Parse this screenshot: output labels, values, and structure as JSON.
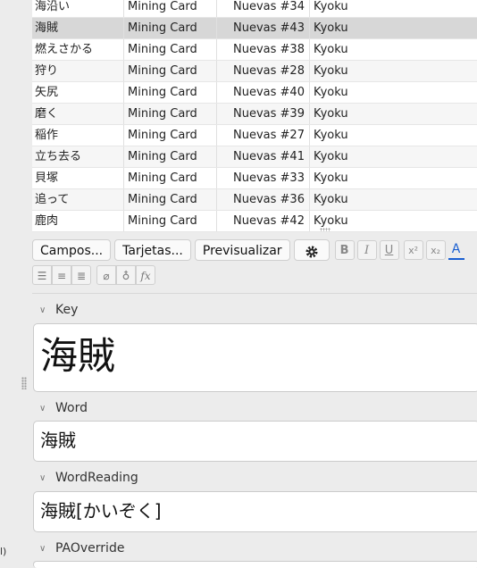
{
  "sidebar": {
    "clipped_text": "l)"
  },
  "table": {
    "rows": [
      {
        "sort": "海沿い",
        "note_type": "Mining Card",
        "card": "Nuevas #34",
        "deck": "Kyoku"
      },
      {
        "sort": "海賊",
        "note_type": "Mining Card",
        "card": "Nuevas #43",
        "deck": "Kyoku"
      },
      {
        "sort": "燃えさかる",
        "note_type": "Mining Card",
        "card": "Nuevas #38",
        "deck": "Kyoku"
      },
      {
        "sort": "狩り",
        "note_type": "Mining Card",
        "card": "Nuevas #28",
        "deck": "Kyoku"
      },
      {
        "sort": "矢尻",
        "note_type": "Mining Card",
        "card": "Nuevas #40",
        "deck": "Kyoku"
      },
      {
        "sort": "磨く",
        "note_type": "Mining Card",
        "card": "Nuevas #39",
        "deck": "Kyoku"
      },
      {
        "sort": "稲作",
        "note_type": "Mining Card",
        "card": "Nuevas #27",
        "deck": "Kyoku"
      },
      {
        "sort": "立ち去る",
        "note_type": "Mining Card",
        "card": "Nuevas #41",
        "deck": "Kyoku"
      },
      {
        "sort": "貝塚",
        "note_type": "Mining Card",
        "card": "Nuevas #33",
        "deck": "Kyoku"
      },
      {
        "sort": "追って",
        "note_type": "Mining Card",
        "card": "Nuevas #36",
        "deck": "Kyoku"
      },
      {
        "sort": "鹿肉",
        "note_type": "Mining Card",
        "card": "Nuevas #42",
        "deck": "Kyoku"
      }
    ],
    "selected_index": 1
  },
  "editor": {
    "buttons": {
      "fields": "Campos...",
      "cards": "Tarjetas...",
      "preview": "Previsualizar"
    },
    "format": {
      "bold": "B",
      "italic": "I",
      "underline": "U",
      "superscript": "x²",
      "subscript": "x₂",
      "color": "A"
    },
    "fields": [
      {
        "name": "Key",
        "value": "海賊"
      },
      {
        "name": "Word",
        "value": "海賊"
      },
      {
        "name": "WordReading",
        "value": "海賊[かいぞく]"
      },
      {
        "name": "PAOverride",
        "value": ""
      }
    ],
    "accent_color": "#1a5fd1"
  }
}
